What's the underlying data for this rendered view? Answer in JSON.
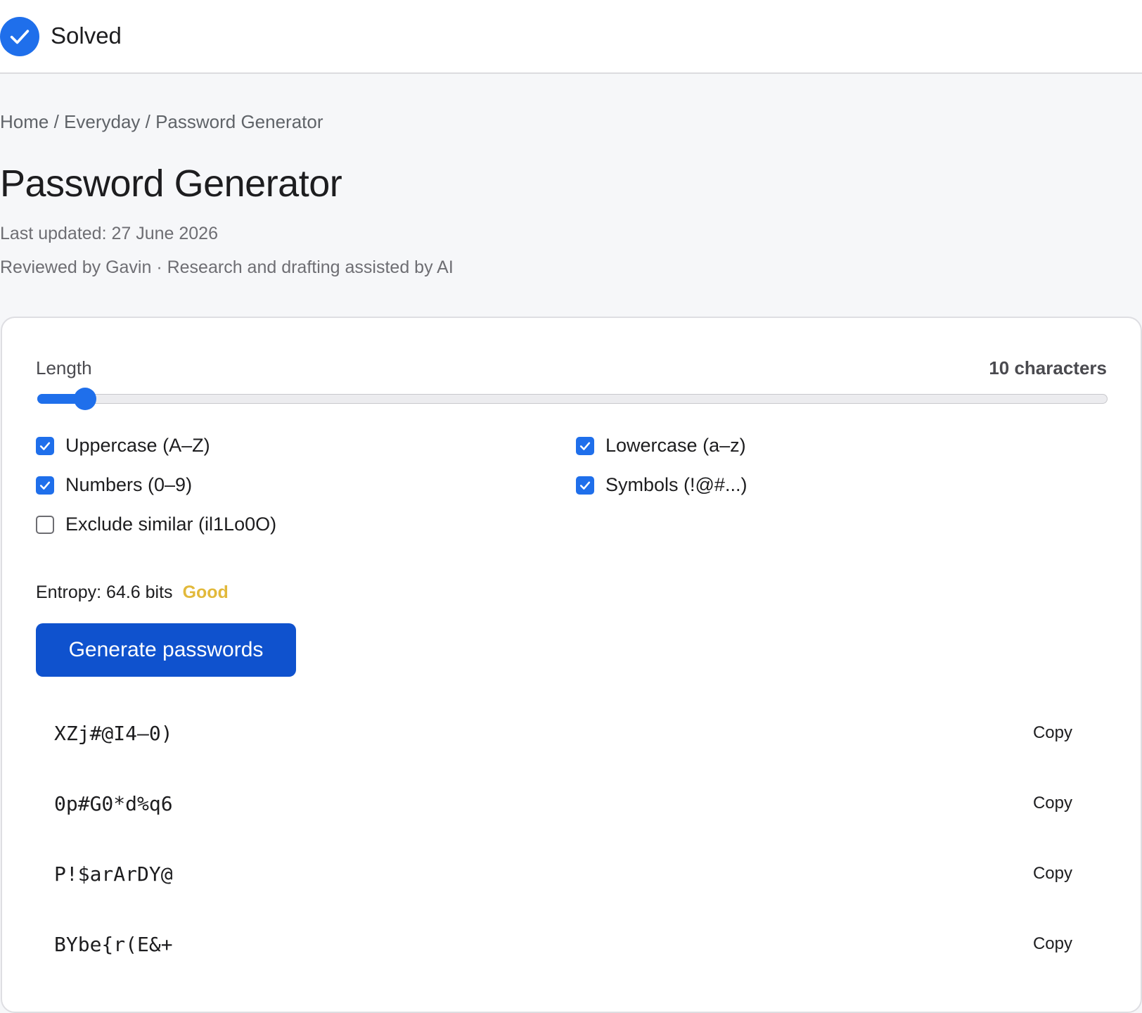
{
  "header": {
    "status_label": "Solved",
    "status_icon": "check-circle-icon"
  },
  "breadcrumb": "Home / Everyday / Password Generator",
  "page": {
    "title": "Password Generator",
    "last_updated": "Last updated: 27 June 2026",
    "reviewed": "Reviewed by Gavin · Research and drafting assisted by AI"
  },
  "generator": {
    "length_label": "Length",
    "length_value": "10 characters",
    "slider_fraction": 0.045,
    "options": [
      {
        "label": "Uppercase (A–Z)",
        "checked": true
      },
      {
        "label": "Lowercase (a–z)",
        "checked": true
      },
      {
        "label": "Numbers (0–9)",
        "checked": true
      },
      {
        "label": "Symbols (!@#...)",
        "checked": true
      },
      {
        "label": "Exclude similar (il1Lo0O)",
        "checked": false
      }
    ],
    "entropy_label": "Entropy: 64.6 bits",
    "entropy_rating": "Good",
    "generate_button": "Generate passwords",
    "passwords": [
      "XZj#@I4–0)",
      "0p#G0*d%q6",
      "P!$arArDY@",
      "BYbe{r(E&+"
    ],
    "copy_label": "Copy"
  },
  "colors": {
    "accent": "#1f6feb",
    "button": "#0f52ce",
    "rating_good": "#e2b93b"
  }
}
